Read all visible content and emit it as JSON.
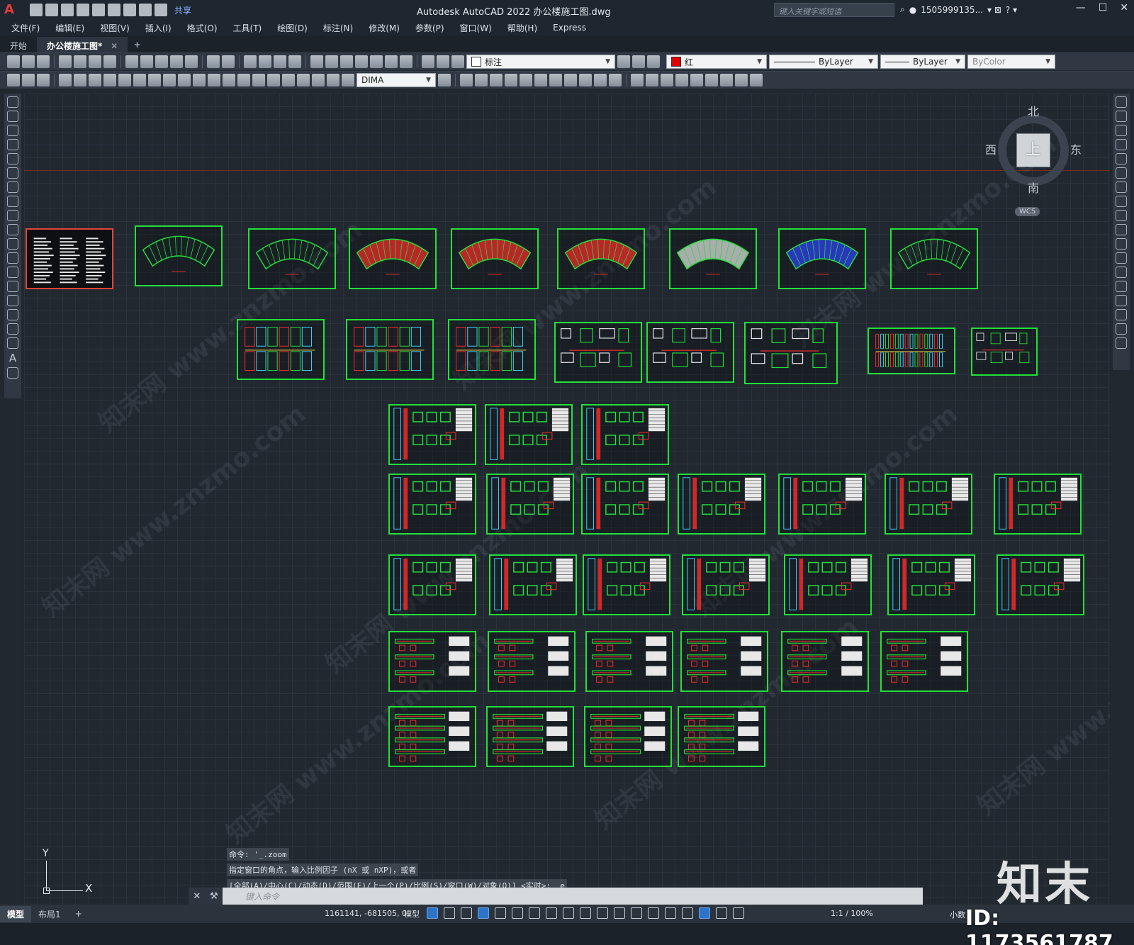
{
  "app": {
    "title": "Autodesk AutoCAD 2022    办公楼施工图.dwg",
    "share": "共享",
    "search_placeholder": "键入关键字或短语",
    "user": "1505999135...",
    "logo": "A"
  },
  "menu": [
    "文件(F)",
    "编辑(E)",
    "视图(V)",
    "插入(I)",
    "格式(O)",
    "工具(T)",
    "绘图(D)",
    "标注(N)",
    "修改(M)",
    "参数(P)",
    "窗口(W)",
    "帮助(H)",
    "Express"
  ],
  "tabs": {
    "start": "开始",
    "doc": "办公楼施工图*",
    "plus": "+"
  },
  "toolbar": {
    "layer": "标注",
    "color": "红",
    "color_hex": "#e00000",
    "linetype": "ByLayer",
    "lineweight": "ByLayer",
    "plotstyle": "ByColor",
    "dimstyle": "DIMA"
  },
  "viewcube": {
    "north": "北",
    "south": "南",
    "west": "西",
    "east": "东",
    "face": "上",
    "wcs": "WCS"
  },
  "ucs": {
    "x": "X",
    "y": "Y"
  },
  "command": {
    "history": [
      "命令: '_.zoom",
      "指定窗口的角点，输入比例因子 (nX 或 nXP)，或者",
      "[全部(A)/中心(C)/动态(D)/范围(E)/上一个(P)/比例(S)/窗口(W)/对象(O)] <实时>: _e"
    ],
    "prompt": "键入命令"
  },
  "status": {
    "model_tab": "模型",
    "layout_tab": "布局1",
    "coords": "1161141, -681505, 0",
    "model": "模型",
    "scale": "1:1 / 100%",
    "units": "小数"
  },
  "brand": {
    "name": "知末",
    "id": "ID: 1173561787"
  },
  "watermark_text": "知末网 www.znzmo.com",
  "colors": {
    "sheet_border": "#22e03a",
    "selected_border": "#e2453a",
    "accent": "#2d73c9"
  }
}
